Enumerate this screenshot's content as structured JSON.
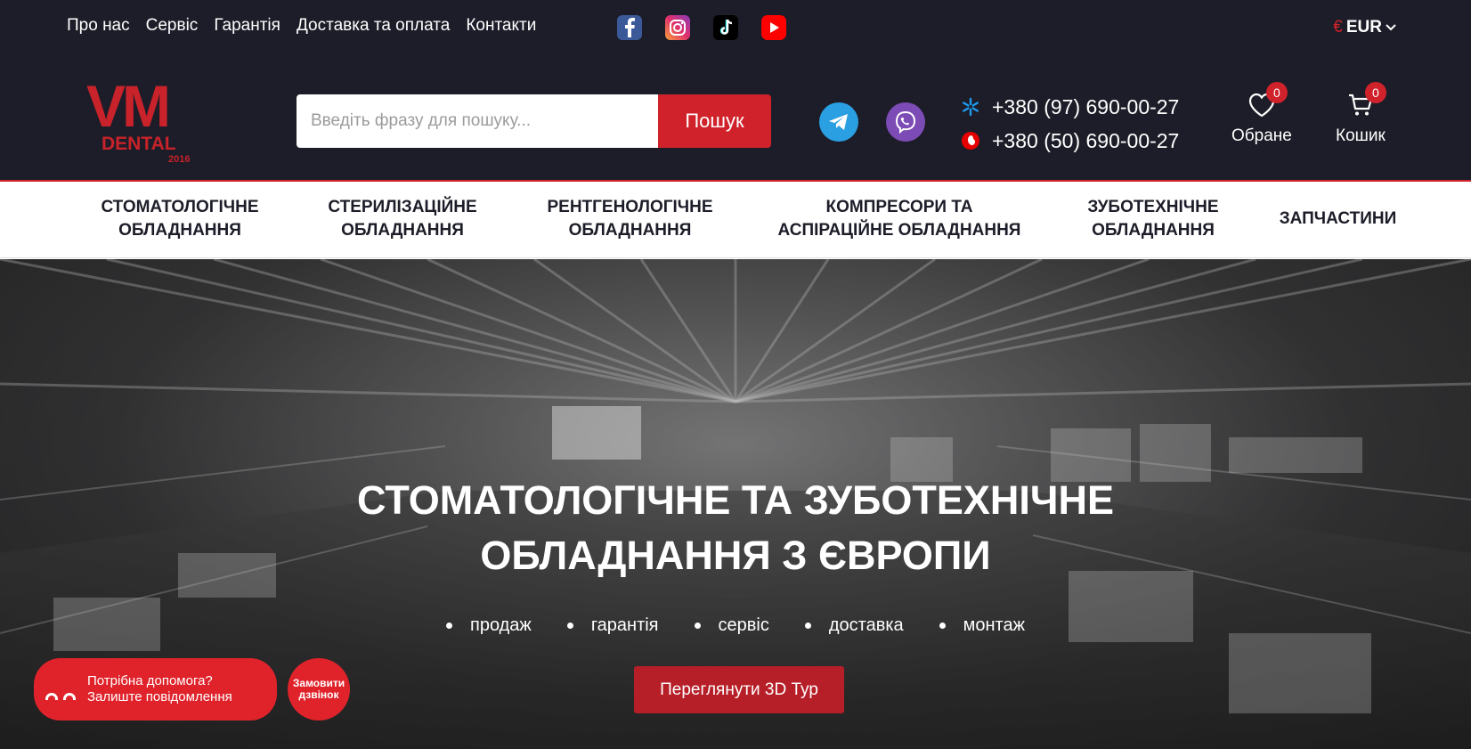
{
  "topbar": {
    "links": [
      "Про нас",
      "Сервіс",
      "Гарантія",
      "Доставка та оплата",
      "Контакти"
    ],
    "socials": [
      "facebook-icon",
      "instagram-icon",
      "tiktok-icon",
      "youtube-icon"
    ],
    "currency_symbol": "€",
    "currency": "EUR"
  },
  "header": {
    "logo": {
      "main": "VM",
      "sub": "DENTAL",
      "year": "2016"
    },
    "search": {
      "placeholder": "Введіть фразу для пошуку...",
      "value": "",
      "button": "Пошук"
    },
    "messengers": [
      "telegram-icon",
      "viber-icon"
    ],
    "phones": [
      {
        "operator": "kyivstar-icon",
        "number": "+380 (97) 690-00-27"
      },
      {
        "operator": "vodafone-icon",
        "number": "+380 (50) 690-00-27"
      }
    ],
    "favorites": {
      "label": "Обране",
      "count": "0"
    },
    "cart": {
      "label": "Кошик",
      "count": "0"
    }
  },
  "categories": [
    "Стоматологічне обладнання",
    "Стерилізаційне обладнання",
    "Рентгенологічне обладнання",
    "Компресори та аспіраційне обладнання",
    "Зуботехнічне обладнання",
    "Запчастини"
  ],
  "hero": {
    "title_line1": "Стоматологічне та зуботехнічне",
    "title_line2": "обладнання з Європи",
    "features": [
      "продаж",
      "гарантія",
      "сервіс",
      "доставка",
      "монтаж"
    ],
    "button": "Переглянути 3D Тур"
  },
  "widget": {
    "help_line1": "Потрібна допомога?",
    "help_line2": "Залиште повідомлення",
    "call_line1": "Замовити",
    "call_line2": "дзвінок"
  },
  "colors": {
    "dark": "#1c1d28",
    "accent": "#d0222b"
  }
}
